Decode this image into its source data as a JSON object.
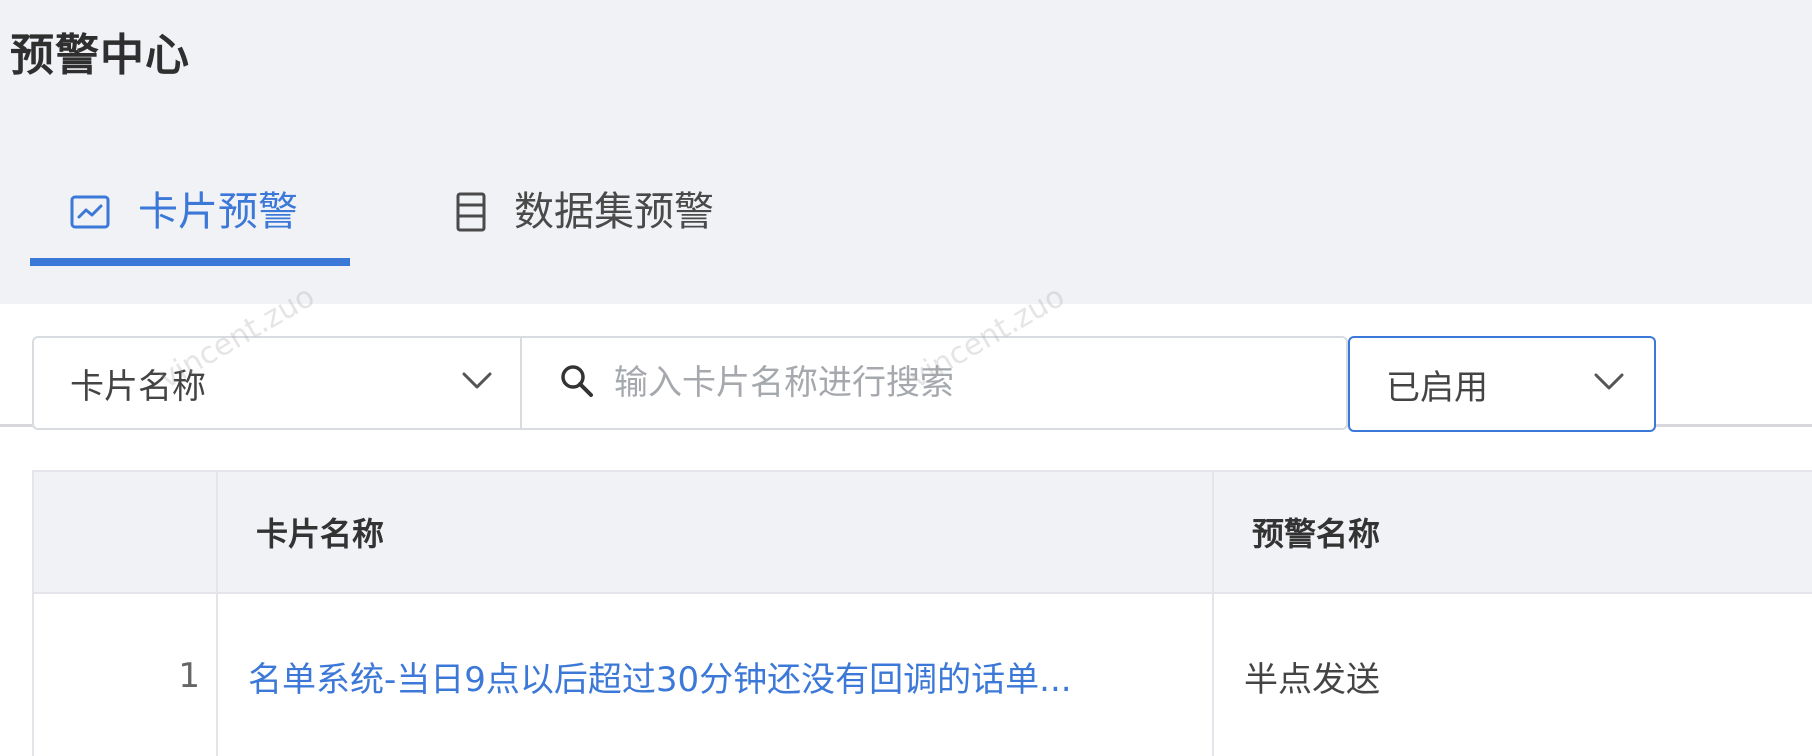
{
  "header": {
    "title": "预警中心"
  },
  "tabs": [
    {
      "label": "卡片预警",
      "icon": "line-chart-icon",
      "active": true
    },
    {
      "label": "数据集预警",
      "icon": "list-doc-icon",
      "active": false
    }
  ],
  "filters": {
    "field_select": {
      "value": "卡片名称",
      "icon": "chevron-down-icon"
    },
    "search": {
      "placeholder": "输入卡片名称进行搜索",
      "value": "",
      "icon": "search-icon"
    },
    "status_select": {
      "value": "已启用",
      "icon": "chevron-down-icon"
    }
  },
  "table": {
    "columns": [
      "卡片名称",
      "预警名称"
    ],
    "rows": [
      {
        "index": "1",
        "card_name": "名单系统-当日9点以后超过30分钟还没有回调的话单...",
        "alert_name": "半点发送"
      }
    ]
  },
  "watermark": "vincent.zuo",
  "colors": {
    "accent": "#3c78d8",
    "header_bg": "#f1f2f6",
    "border": "#d8dbe0"
  }
}
